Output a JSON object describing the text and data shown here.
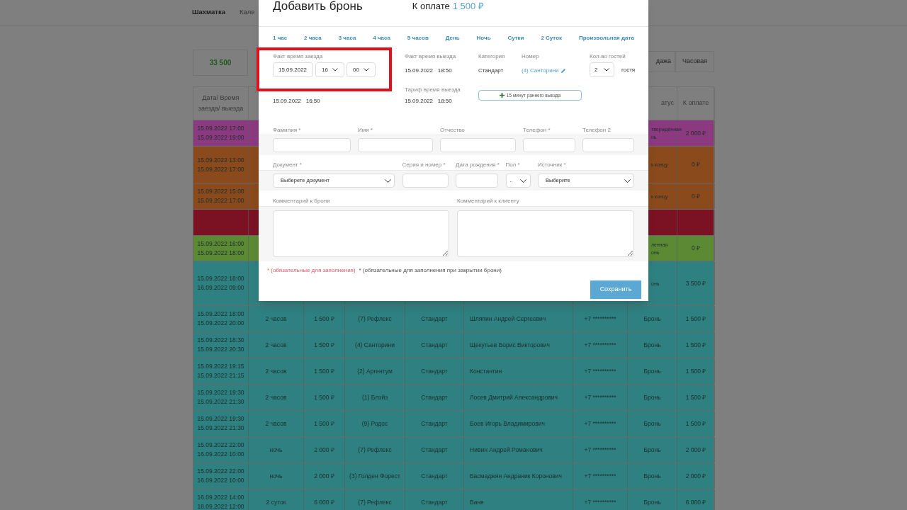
{
  "nav": {
    "tabs": [
      {
        "label": "Шахматка",
        "selected": true
      },
      {
        "label": "Кале",
        "selected": false
      }
    ]
  },
  "summary": {
    "total": "33 500"
  },
  "view_buttons": [
    "дажа",
    "Часовая"
  ],
  "table": {
    "header": {
      "date": "Дата/ Время заезда/ выезда",
      "status": "атус",
      "to_pay": "К оплате"
    },
    "rows": [
      {
        "color": "#8c3a80",
        "checkin": "15.09.2022 17:00",
        "checkout": "15.09.2022 19:00",
        "status_lines": [
          "тверждённая",
          "нь"
        ],
        "to_pay": "2 000 ₽"
      },
      {
        "color": "#8a4a1c",
        "checkin": "15.09.2022 13:00",
        "checkout": "15.09.2022 17:00",
        "status_lines": [
          "к концу"
        ],
        "to_pay": "0 ₽"
      },
      {
        "color": "#8a4a1c",
        "checkin": "15.09.2022 15:00",
        "checkout": "15.09.2022 17:00",
        "status_lines": [
          "к концу"
        ],
        "to_pay": "0 ₽"
      },
      {
        "color": "#7a1224"
      },
      {
        "color": "#5c8a34",
        "checkin": "15.09.2022 16:00",
        "checkout": "15.09.2022 18:00",
        "status_lines": [
          "ленная",
          "онь"
        ],
        "to_pay": "0 ₽"
      },
      {
        "color": "#2f8080",
        "checkin": "15.09.2022 18:00",
        "checkout": "16.09.2022 09:00",
        "status_lines": [
          "онь"
        ],
        "to_pay": "3 500 ₽"
      },
      {
        "color": "#2f8080",
        "checkin": "15.09.2022 18:00",
        "checkout": "15.09.2022 20:00",
        "duration": "2 часов",
        "price": "1 500 ₽",
        "room": "(7) Рефлекс",
        "category": "Стандарт",
        "guest": "Шляпин Андрей Сергеевич",
        "phone": "+7 **********",
        "status_lines": [
          "Бронь"
        ],
        "to_pay": "1 500 ₽"
      },
      {
        "color": "#2f8080",
        "checkin": "15.09.2022 18:30",
        "checkout": "15.09.2022 20:30",
        "duration": "2 часов",
        "price": "1 500 ₽",
        "room": "(4) Санторини",
        "category": "Стандарт",
        "guest": "Щекутьев Борис Викторович",
        "phone": "+7 **********",
        "status_lines": [
          "Бронь"
        ],
        "to_pay": "1 500 ₽"
      },
      {
        "color": "#2f8080",
        "checkin": "15.09.2022 19:15",
        "checkout": "15.09.2022 21:15",
        "duration": "2 часов",
        "price": "1 500 ₽",
        "room": "(2) Аргентум",
        "category": "Стандарт",
        "guest": "Константин",
        "phone": "+7 **********",
        "status_lines": [
          "Бронь"
        ],
        "to_pay": "1 500 ₽"
      },
      {
        "color": "#2f8080",
        "checkin": "15.09.2022 19:30",
        "checkout": "15.09.2022 21:30",
        "duration": "2 часов",
        "price": "1 500 ₽",
        "room": "(1) Блэйз",
        "category": "Стандарт",
        "guest": "Лосев Дмитрий Александрович",
        "phone": "+7 **********",
        "status_lines": [
          "Бронь"
        ],
        "to_pay": "1 500 ₽"
      },
      {
        "color": "#2f8080",
        "checkin": "15.09.2022 19:30",
        "checkout": "15.09.2022 21:30",
        "duration": "2 часов",
        "price": "1 500 ₽",
        "room": "(9) Родос",
        "category": "Стандарт",
        "guest": "Боев Игорь Владимирович",
        "phone": "+7 **********",
        "status_lines": [
          "Бронь"
        ],
        "to_pay": "1 500 ₽"
      },
      {
        "color": "#2f8080",
        "checkin": "15.09.2022 22:00",
        "checkout": "16.09.2022 10:00",
        "duration": "ночь",
        "price": "2 000 ₽",
        "room": "(7) Рефлекс",
        "category": "Стандарт",
        "guest": "Нивин Андрей Романович",
        "phone": "+7 **********",
        "status_lines": [
          "Бронь"
        ],
        "to_pay": "2 000 ₽"
      },
      {
        "color": "#2f8080",
        "checkin": "15.09.2022 22:00",
        "checkout": "16.09.2022 10:00",
        "duration": "ночь",
        "price": "2 000 ₽",
        "room": "(3) Голден Форест",
        "category": "Стандарт",
        "guest": "Басмаджян Андраник Коронович",
        "phone": "+7 **********",
        "status_lines": [
          "Бронь"
        ],
        "to_pay": "2 000 ₽"
      },
      {
        "color": "#2f8080",
        "checkin": "16.09.2022 14:00",
        "checkout": "18.09.2022 12:00",
        "duration": "2 суток",
        "price": "6 000 ₽",
        "room": "(7) Рефлекс",
        "category": "Стандарт",
        "guest": "Ваня",
        "phone": "+7 **********",
        "status_lines": [
          "Бронь"
        ],
        "to_pay": "6 000 ₽"
      }
    ]
  },
  "modal": {
    "title": "Добавить бронь",
    "payment_label": "К оплате",
    "payment_amount": "1 500 ₽",
    "tariffs": [
      "1 час",
      "2 часа",
      "3 часа",
      "4 часа",
      "5 часов",
      "День",
      "Ночь",
      "Сутки",
      "2 Суток",
      "Произвольная дата"
    ],
    "checkin": {
      "label": "Факт время заезда",
      "date": "15.09.2022",
      "hour": "16",
      "minute": "00",
      "highlighted": true
    },
    "tariff_checkin_value": "15.09.2022   16:50",
    "checkout": {
      "label": "Факт время выезда",
      "value": "15.09.2022   18:50"
    },
    "tariff_checkout": {
      "label": "Тариф время выезда",
      "value": "15.09.2022   18:50"
    },
    "category": {
      "label": "Категория",
      "value": "Стандарт"
    },
    "room": {
      "label": "Номер",
      "value": "(4) Санторини"
    },
    "guests": {
      "label": "Кол-во гостей",
      "value": "2",
      "unit": "гостя"
    },
    "early_button": "15 минут раннего выезда",
    "guest_fields": [
      {
        "label": "Фамилия *"
      },
      {
        "label": "Имя *"
      },
      {
        "label": "Отчество"
      },
      {
        "label": "Телефон *"
      },
      {
        "label": "Телефон 2"
      }
    ],
    "document_fields": [
      {
        "label": "Документ *",
        "kind": "select",
        "value": "Выберете документ"
      },
      {
        "label": "Серия и номер *",
        "kind": "input"
      },
      {
        "label": "Дата рождения *",
        "kind": "input"
      },
      {
        "label": "Пол *",
        "kind": "select",
        "value": ".."
      },
      {
        "label": "Источник *",
        "kind": "select",
        "value": "Выберите"
      }
    ],
    "comments": [
      {
        "label": "Комментарий к брони"
      },
      {
        "label": "Комментарий к клиенту"
      }
    ],
    "notes": [
      {
        "kind": "required",
        "text": "* (обязательные для заполнения)"
      },
      {
        "kind": "closing",
        "text": "* (обязательные для заполнения при закрытии брони)"
      }
    ],
    "save_button": "Сохранить"
  }
}
